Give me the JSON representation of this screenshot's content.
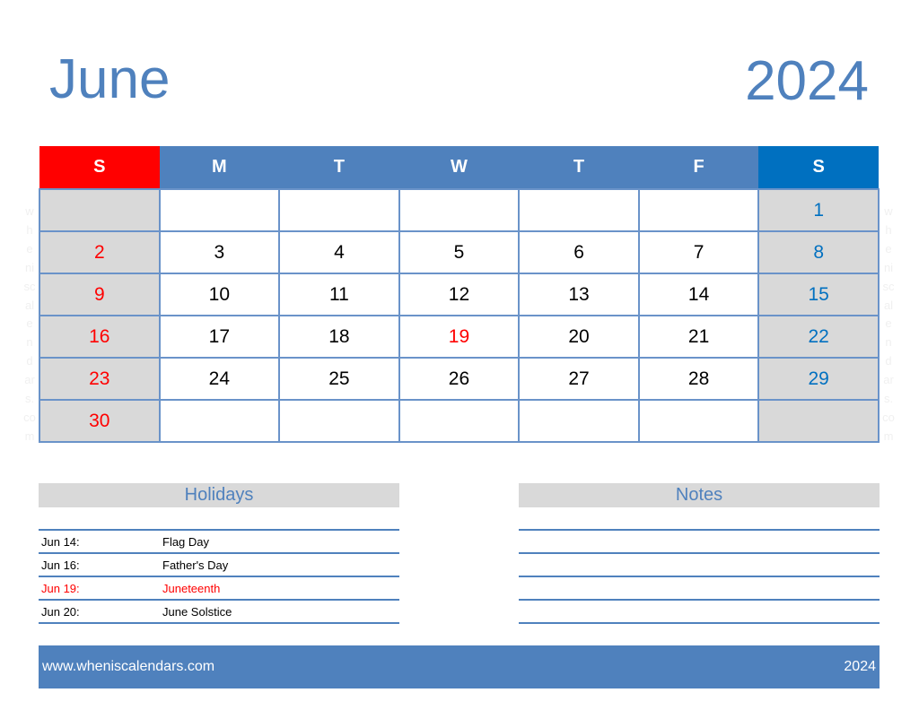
{
  "header": {
    "month": "June",
    "year": "2024"
  },
  "calendar": {
    "weekdays": [
      "S",
      "M",
      "T",
      "W",
      "T",
      "F",
      "S"
    ],
    "weeks": [
      [
        "",
        "",
        "",
        "",
        "",
        "",
        "1"
      ],
      [
        "2",
        "3",
        "4",
        "5",
        "6",
        "7",
        "8"
      ],
      [
        "9",
        "10",
        "11",
        "12",
        "13",
        "14",
        "15"
      ],
      [
        "16",
        "17",
        "18",
        "19",
        "20",
        "21",
        "22"
      ],
      [
        "23",
        "24",
        "25",
        "26",
        "27",
        "28",
        "29"
      ],
      [
        "30",
        "",
        "",
        "",
        "",
        "",
        ""
      ]
    ],
    "holiday_dates": [
      "19"
    ],
    "colors": {
      "sunday": "#ff0000",
      "saturday": "#0070c0",
      "weekday_header": "#4f81bd",
      "weekend_cell": "#d9d9d9"
    }
  },
  "watermark": {
    "text": "wheniscalendars.com"
  },
  "holidays": {
    "title": "Holidays",
    "items": [
      {
        "date": "Jun 14:",
        "name": "Flag Day",
        "highlight": false
      },
      {
        "date": "Jun 16:",
        "name": "Father's Day",
        "highlight": false
      },
      {
        "date": "Jun 19:",
        "name": "Juneteenth",
        "highlight": true
      },
      {
        "date": "Jun 20:",
        "name": "June Solstice",
        "highlight": false
      }
    ]
  },
  "notes": {
    "title": "Notes",
    "line_count": 5
  },
  "footer": {
    "website": "www.wheniscalendars.com",
    "year": "2024"
  }
}
